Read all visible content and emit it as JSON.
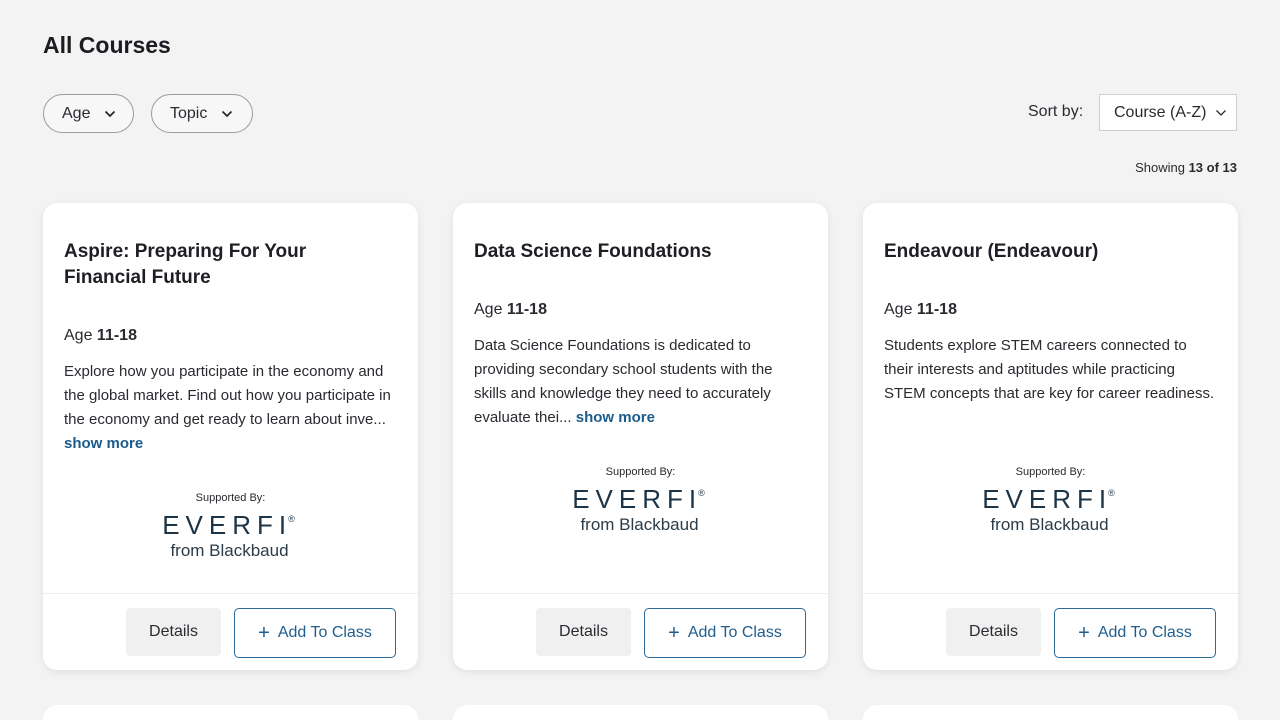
{
  "page": {
    "title": "All Courses"
  },
  "filters": {
    "age_label": "Age",
    "topic_label": "Topic"
  },
  "sort": {
    "label": "Sort by:",
    "selected": "Course (A-Z)"
  },
  "results": {
    "showing_prefix": "Showing",
    "count": "13 of 13"
  },
  "cards": [
    {
      "title": "Aspire: Preparing For Your Financial Future",
      "age_prefix": "Age",
      "age_range": "11-18",
      "description": "Explore how you participate in the economy and the global market. Find out how you participate in the economy and get ready to learn about inve...",
      "show_more": "show more",
      "supported_by": "Supported By:",
      "sponsor_logo": "EVERFI",
      "sponsor_sub": "from Blackbaud",
      "details_label": "Details",
      "add_label": "Add To Class"
    },
    {
      "title": "Data Science Foundations",
      "age_prefix": "Age",
      "age_range": "11-18",
      "description": "Data Science Foundations is dedicated to providing secondary school students with the skills and knowledge they need to accurately evaluate thei...",
      "show_more": "show more",
      "supported_by": "Supported By:",
      "sponsor_logo": "EVERFI",
      "sponsor_sub": "from Blackbaud",
      "details_label": "Details",
      "add_label": "Add To Class"
    },
    {
      "title": "Endeavour (Endeavour)",
      "age_prefix": "Age",
      "age_range": "11-18",
      "description": "Students explore STEM careers connected to their interests and aptitudes while practicing STEM concepts that are key for career readiness.",
      "show_more": "",
      "supported_by": "Supported By:",
      "sponsor_logo": "EVERFI",
      "sponsor_sub": "from Blackbaud",
      "details_label": "Details",
      "add_label": "Add To Class"
    }
  ],
  "icons": {
    "filter_chevron": "chevron-down-icon",
    "add": "plus-icon"
  },
  "colors": {
    "accent": "#1f5e8e",
    "background": "#f3f3f4",
    "logo": "#1d3446"
  }
}
